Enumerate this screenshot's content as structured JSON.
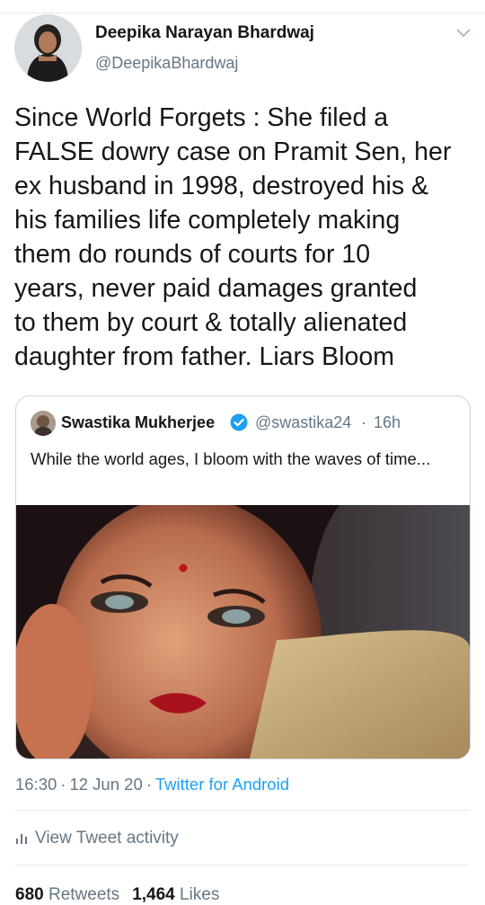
{
  "author": {
    "display_name": "Deepika Narayan Bhardwaj",
    "handle": "@DeepikaBhardwaj",
    "avatar_icon": "user-avatar-photo"
  },
  "tweet": {
    "text": "Since World Forgets : She filed a\nFALSE dowry case on Pramit Sen, her\nex husband in 1998, destroyed his &\nhis families life completely making\nthem do rounds of courts for 10\nyears, never paid damages granted\nto them by court & totally alienated\ndaughter from father.  Liars Bloom"
  },
  "quote": {
    "display_name": "Swastika Mukherjee",
    "handle": "@swastika24",
    "separator": "·",
    "time": "16h",
    "text": "While the world ages, I bloom with the waves of time...",
    "media_icon": "portrait-photo"
  },
  "meta": {
    "time": "16:30",
    "date": "12 Jun 20",
    "source": "Twitter for Android",
    "dot": "·"
  },
  "activity": {
    "label": "View Tweet activity"
  },
  "stats": {
    "retweets_count": "680",
    "retweets_label": "Retweets",
    "likes_count": "1,464",
    "likes_label": "Likes"
  },
  "colors": {
    "accent": "#1da1f2",
    "secondary_text": "#657786",
    "primary_text": "#14171a",
    "divider": "#e6ecf0"
  }
}
